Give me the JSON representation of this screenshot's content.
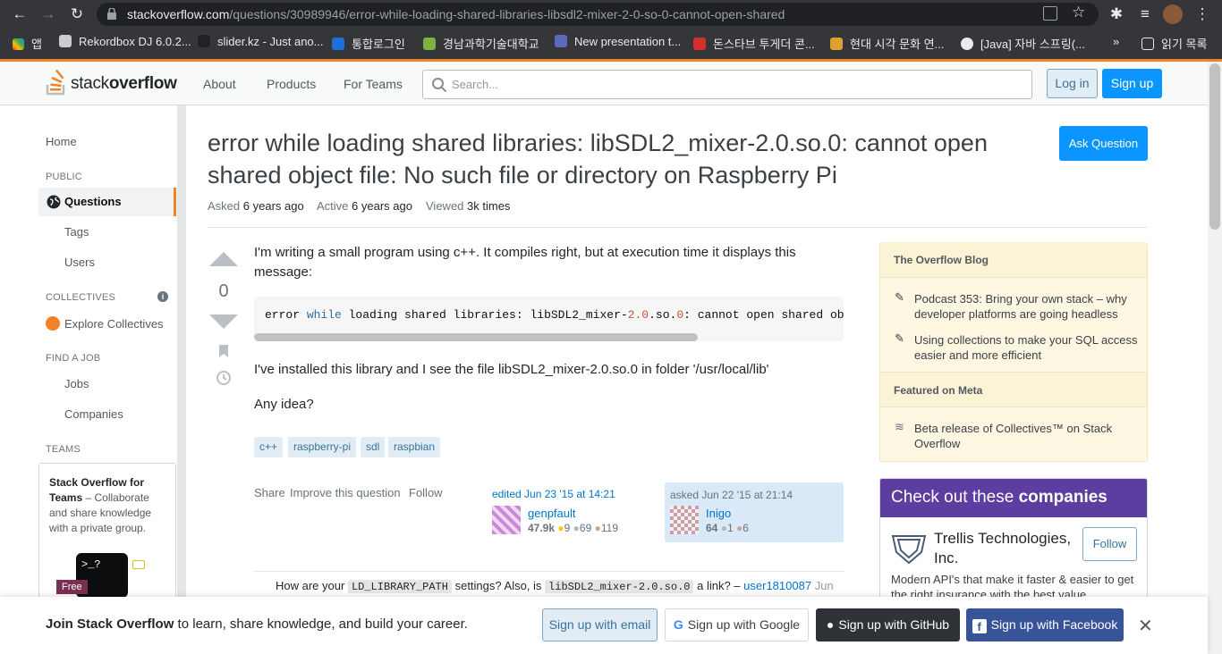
{
  "browser": {
    "url_host": "stackoverflow.com",
    "url_path": "/questions/30989946/error-while-loading-shared-libraries-libsdl2-mixer-2-0-so-0-cannot-open-shared",
    "bookmarks": [
      "앱",
      "Rekordbox DJ 6.0.2...",
      "slider.kz - Just ano...",
      "통합로그인",
      "경남과학기술대학교",
      "New presentation t...",
      "돈스타브 투게더 콘...",
      "현대 시각 문화 연...",
      "[Java] 자바 스프링(...",
      "»",
      "읽기 목록"
    ]
  },
  "header": {
    "logo_plain": "stack",
    "logo_bold": "overflow",
    "nav": [
      "About",
      "Products",
      "For Teams"
    ],
    "search_placeholder": "Search...",
    "login": "Log in",
    "signup": "Sign up"
  },
  "leftnav": {
    "home": "Home",
    "public": "PUBLIC",
    "questions": "Questions",
    "tags": "Tags",
    "users": "Users",
    "collectives": "COLLECTIVES",
    "explore": "Explore Collectives",
    "findjob": "FIND A JOB",
    "jobs": "Jobs",
    "companies": "Companies",
    "teams": "TEAMS",
    "teams_title": "Stack Overflow for Teams",
    "teams_desc": " – Collaborate and share knowledge with a private group.",
    "free": "Free"
  },
  "question": {
    "title": "error while loading shared libraries: libSDL2_mixer-2.0.so.0: cannot open shared object file: No such file or directory on Raspberry Pi",
    "ask_button": "Ask Question",
    "asked_label": "Asked",
    "asked_value": "6 years ago",
    "active_label": "Active",
    "active_value": "6 years ago",
    "viewed_label": "Viewed",
    "viewed_value": "3k times",
    "votes": "0",
    "p1": "I'm writing a small program using c++. It compiles right, but at execution time it displays this message:",
    "p2": "I've installed this library and I see the file libSDL2_mixer-2.0.so.0 in folder '/usr/local/lib'",
    "p3": "Any idea?",
    "tags": [
      "c++",
      "raspberry-pi",
      "sdl",
      "raspbian"
    ],
    "menu": [
      "Share",
      "Improve this question",
      "Follow"
    ],
    "edited": "edited Jun 23 '15 at 14:21",
    "editor": "genpfault",
    "editor_rep": "47.9k",
    "editor_gold": "9",
    "editor_silver": "69",
    "editor_bronze": "119",
    "asked": "asked Jun 22 '15 at 21:14",
    "asker": "Inigo",
    "asker_rep": "64",
    "asker_silver": "1",
    "asker_bronze": "6",
    "comment_pre": "How are your",
    "comment_code1": "LD_LIBRARY_PATH",
    "comment_mid": "settings? Also, is",
    "comment_code2": "libSDL2_mixer-2.0.so.0",
    "comment_post": "a link? –",
    "comment_user": "user1810087",
    "comment_date": "Jun"
  },
  "sidebar": {
    "blog_head": "The Overflow Blog",
    "blog1": "Podcast 353: Bring your own stack – why developer platforms are going headless",
    "blog2": "Using collections to make your SQL access easier and more efficient",
    "meta_head": "Featured on Meta",
    "meta1": "Beta release of Collectives™ on Stack Overflow",
    "companies_head_plain": "Check out these",
    "companies_head_bold": "companies",
    "company_name": "Trellis Technologies, Inc.",
    "company_follow": "Follow",
    "company_desc": "Modern API's that make it faster & easier to get the right insurance with the best value"
  },
  "banner": {
    "bold": "Join Stack Overflow",
    "text": " to learn, share knowledge, and build your career.",
    "email": "Sign up with email",
    "google": "Sign up with Google",
    "github": "Sign up with GitHub",
    "facebook": "Sign up with Facebook"
  },
  "colors": {
    "accent": "#f48225",
    "link": "#0074cc",
    "primary": "#0a95ff",
    "purple": "#5b3ea0"
  }
}
